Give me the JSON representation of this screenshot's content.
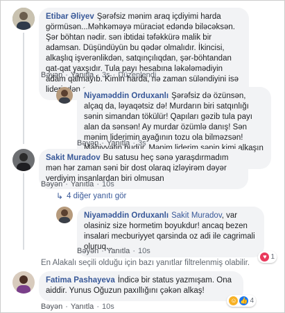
{
  "actions": {
    "like": "Bəyən",
    "reply": "Yanıtla",
    "edited": "Düzenlendi"
  },
  "comments": [
    {
      "author": "Etibar Əliyev",
      "text": "Şərəfsiz mənim araq içdiyimi harda görmüsən...Məhkəməyə müraciət edəndə biləcəksən. Şər böhtan nədir. sən ibtidai təfəkkürə malik bir adamsan. Düşündüyün bu qədər olmalıdır. İkincisi, alkaşlıq işverənlikdən, satqınçılıqdan, şər-böhtandan qat-qat yaxşıdır. Tula payı hesabına ləkələmədiyin adam qalmayıb. Kimin harda, nə zaman süləndiyini isə liderindən soruş...",
      "time": "3s",
      "edited": true
    },
    {
      "author": "Niyaməddin Orduxanlı",
      "text": "Şərəfsiz də özünsən, alçaq da, ləyaqətsiz də! Murdarın biri satqınlığı sənin simandan tökülür! Qapıları gəzib tula payı alan da sənsən! Ay murdar özümlə danış! Sən mənim liderimin ayağının tozu ola bilməzsən! Mahiyyətin budur. Mənim liderim sənin kimi alkaşın adını çəkib?",
      "time": "3s"
    },
    {
      "author": "Sakit Muradov",
      "text": "Bu satusu heç sənə yaraşdırmadım mən hər zaman səni bir dost olaraq izləyirəm dəyər verdiyim insanlardan biri olmusan",
      "time": "10s"
    },
    {
      "more": "4 diğer yanıtı gör"
    },
    {
      "author": "Niyaməddin Orduxanlı",
      "mention": "Sakit Muradov",
      "text": ", var olasiniz size hormetim boyukdur! ancaq bezen insalari mecburiyyet qarsinda oz adi ile cagrimali oluruq...",
      "time": "10s",
      "reaction_count": "1"
    },
    {
      "notice": "En Alakalı seçili olduğu için bazı yanıtlar filtrelenmiş olabilir."
    },
    {
      "author": "Fatima Pashayeva",
      "text": "İndicə bir status yazmışam. Ona aiddir. Yunus Oğuzun paxıllığını çəkən alkaş!",
      "time": "10s",
      "reaction_count": "4"
    }
  ],
  "colors": {
    "link": "#385898",
    "like_blue": "#1877f2",
    "haha_yellow": "#f7b125",
    "love_red": "#e9395c"
  }
}
